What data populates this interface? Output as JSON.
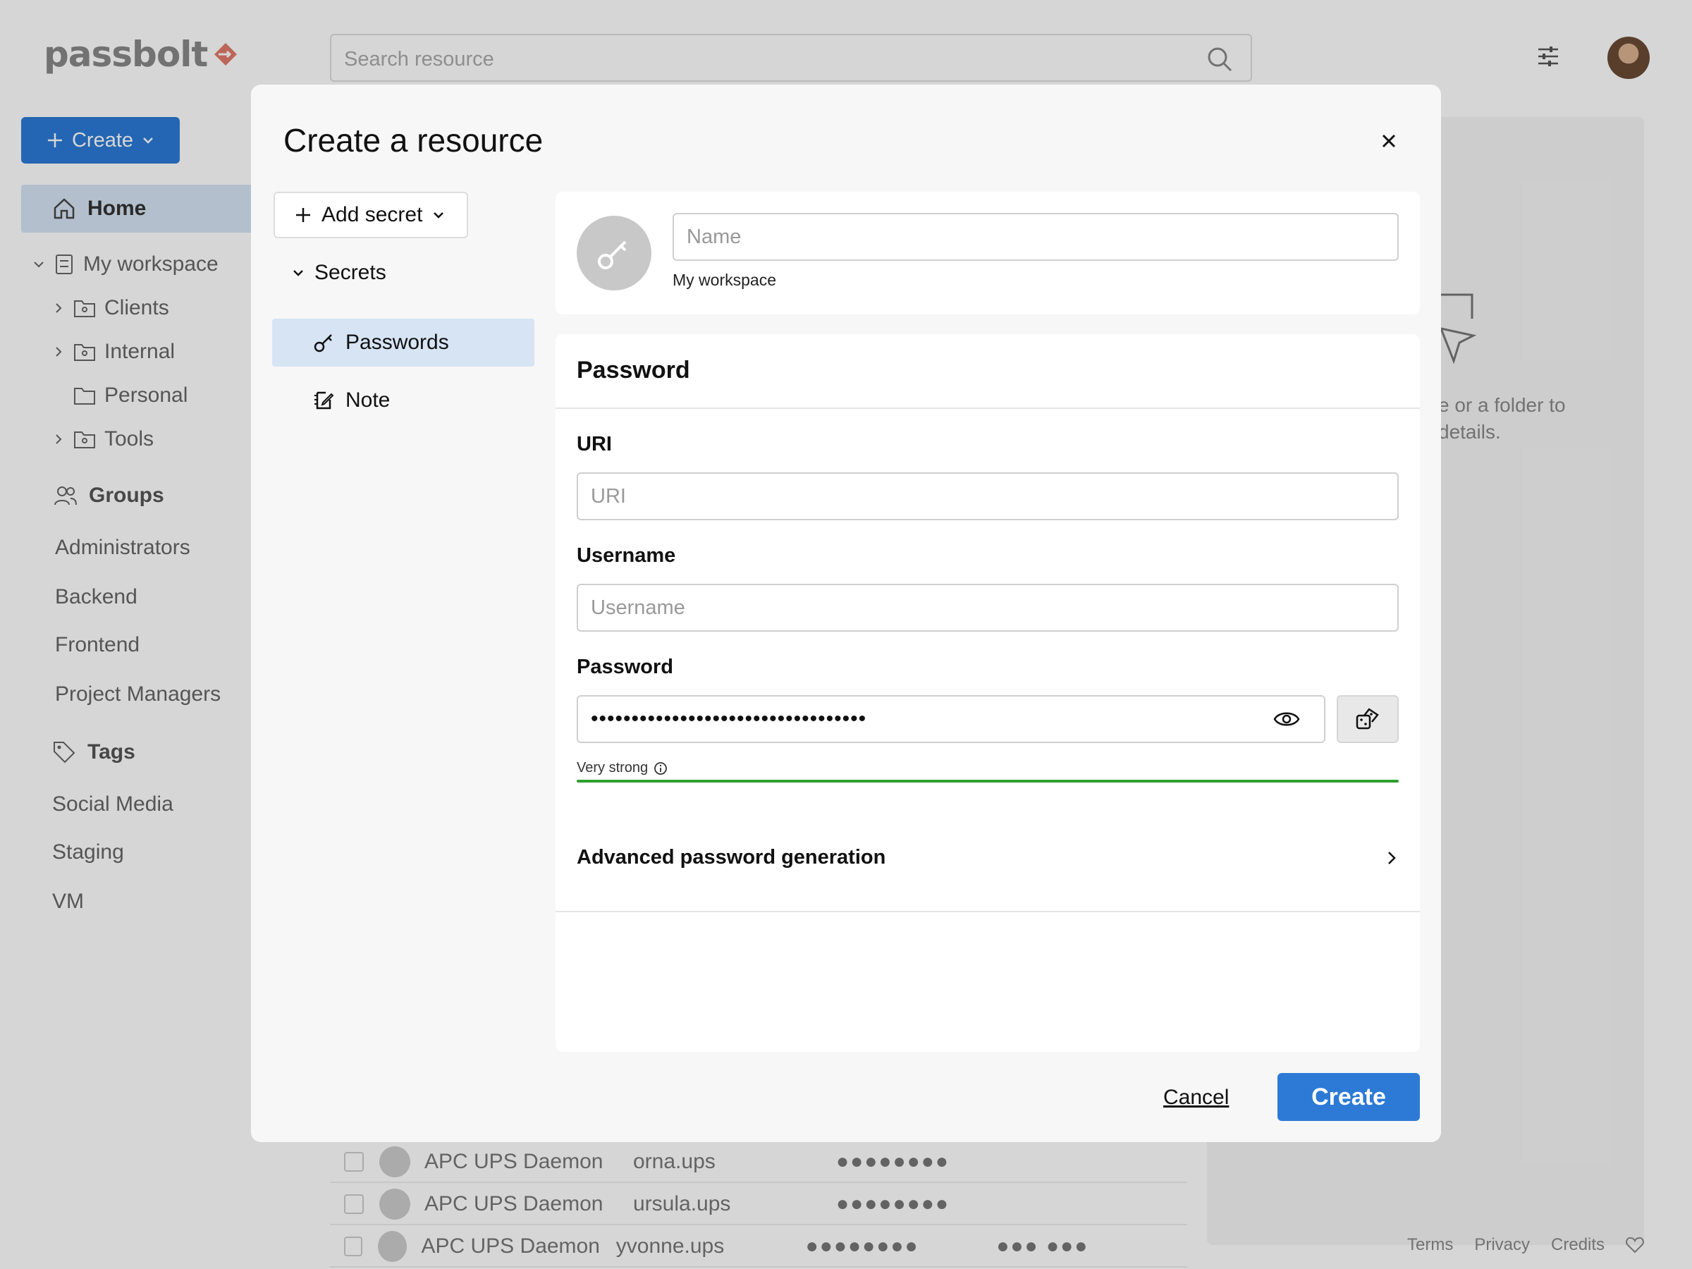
{
  "app": {
    "logo_text": "passbolt",
    "search_placeholder": "Search resource",
    "create_label": "Create",
    "nav": {
      "home": "Home",
      "workspace": "My workspace",
      "folders": [
        {
          "label": "Clients",
          "expandable": true
        },
        {
          "label": "Internal",
          "expandable": true
        },
        {
          "label": "Personal",
          "expandable": false
        },
        {
          "label": "Tools",
          "expandable": true
        }
      ],
      "groups_heading": "Groups",
      "groups": [
        "Administrators",
        "Backend",
        "Frontend",
        "Project Managers"
      ],
      "tags_heading": "Tags",
      "tags": [
        "Social Media",
        "Staging",
        "VM"
      ]
    },
    "right_panel_hint_line1": "e or a folder to",
    "right_panel_hint_line2": "details.",
    "table_rows": [
      {
        "name": "APC UPS Daemon",
        "username": "orna.ups",
        "password": "●●●●●●●●",
        "extra": ""
      },
      {
        "name": "APC UPS Daemon",
        "username": "ursula.ups",
        "password": "●●●●●●●●",
        "extra": ""
      },
      {
        "name": "APC UPS Daemon",
        "username": "yvonne.ups",
        "password": "●●●●●●●●",
        "extra": "●●● ●●●"
      }
    ],
    "footer": {
      "terms": "Terms",
      "privacy": "Privacy",
      "credits": "Credits"
    }
  },
  "dialog": {
    "title": "Create a resource",
    "add_secret_label": "Add secret",
    "secrets_heading": "Secrets",
    "side_items": [
      {
        "label": "Passwords",
        "icon": "key-icon",
        "active": true
      },
      {
        "label": "Note",
        "icon": "note-icon",
        "active": false
      }
    ],
    "name_placeholder": "Name",
    "folder_crumb": "My workspace",
    "section_title": "Password",
    "uri_label": "URI",
    "uri_placeholder": "URI",
    "username_label": "Username",
    "username_placeholder": "Username",
    "password_label": "Password",
    "password_value": "••••••••••••••••••••••••••••••••••",
    "strength_label": "Very strong",
    "strength_color": "#2ea02e",
    "advanced_label": "Advanced password generation",
    "cancel_label": "Cancel",
    "create_label": "Create",
    "accent_color": "#2c7ad6"
  }
}
